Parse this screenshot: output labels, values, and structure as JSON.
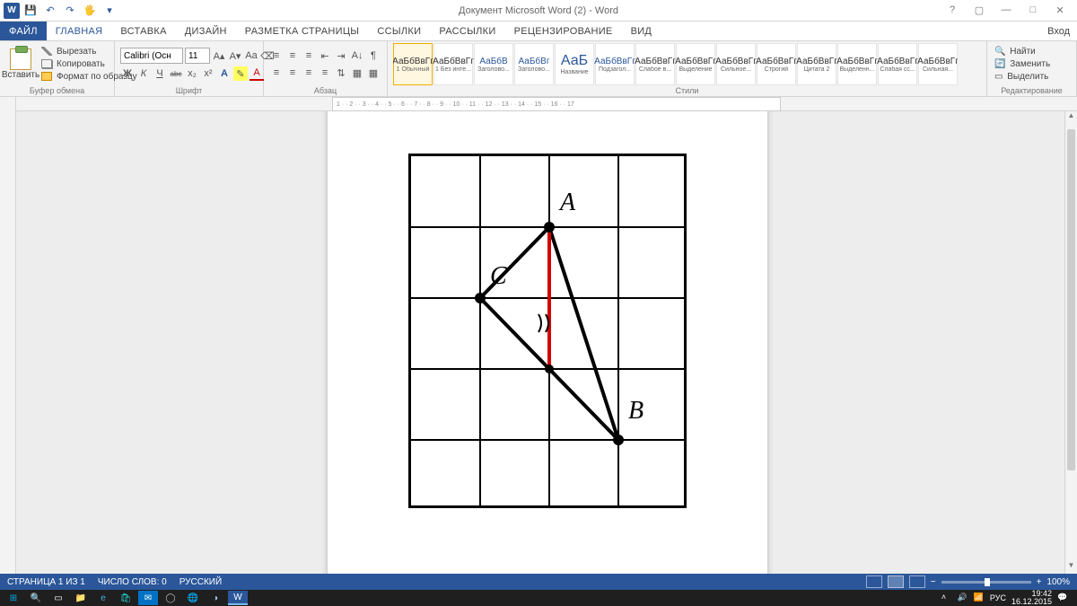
{
  "title": "Документ Microsoft Word (2) - Word",
  "qat": {
    "save": "💾",
    "undo": "↶",
    "redo": "↷",
    "touch": "🖐"
  },
  "win": {
    "help": "?",
    "ribopts": "▢",
    "min": "—",
    "max": "□",
    "close": "✕"
  },
  "tabs": {
    "file": "ФАЙЛ",
    "items": [
      "ГЛАВНАЯ",
      "ВСТАВКА",
      "ДИЗАЙН",
      "РАЗМЕТКА СТРАНИЦЫ",
      "ССЫЛКИ",
      "РАССЫЛКИ",
      "РЕЦЕНЗИРОВАНИЕ",
      "ВИД"
    ],
    "active": 0,
    "signin": "Вход"
  },
  "ribbon": {
    "clipboard": {
      "paste": "Вставить",
      "cut": "Вырезать",
      "copy": "Копировать",
      "format": "Формат по образцу",
      "label": "Буфер обмена"
    },
    "font": {
      "name": "Calibri (Осн",
      "size": "11",
      "grow": "A▴",
      "shrink": "A▾",
      "case": "Aa",
      "clear": "⌫",
      "bold": "Ж",
      "italic": "К",
      "underline": "Ч",
      "strike": "abc",
      "sub": "x₂",
      "sup": "x²",
      "effects": "A",
      "highlight": "✎",
      "color": "A",
      "label": "Шрифт"
    },
    "para": {
      "bul": "≡",
      "num": "≡",
      "ml": "≡",
      "dec": "⇤",
      "inc": "⇥",
      "sort": "A↓",
      "marks": "¶",
      "al": "≡",
      "ac": "≡",
      "ar": "≡",
      "aj": "≡",
      "ls": "⇅",
      "shade": "▦",
      "bord": "▦",
      "label": "Абзац"
    },
    "styles": {
      "items": [
        {
          "preview": "АаБбВвГг",
          "name": "1 Обычный",
          "cls": "",
          "sel": true
        },
        {
          "preview": "АаБбВвГг",
          "name": "1 Без инте...",
          "cls": ""
        },
        {
          "preview": "АаБбВ",
          "name": "Заголово...",
          "cls": "blue"
        },
        {
          "preview": "АаБбВг",
          "name": "Заголово...",
          "cls": "blue"
        },
        {
          "preview": "АаБ",
          "name": "Название",
          "cls": "big"
        },
        {
          "preview": "АаБбВвГг",
          "name": "Подзагол...",
          "cls": "blue"
        },
        {
          "preview": "АаБбВвГг",
          "name": "Слабое в...",
          "cls": ""
        },
        {
          "preview": "АаБбВвГг",
          "name": "Выделение",
          "cls": ""
        },
        {
          "preview": "АаБбВвГг",
          "name": "Сильное...",
          "cls": ""
        },
        {
          "preview": "АаБбВвГг",
          "name": "Строгий",
          "cls": ""
        },
        {
          "preview": "АаБбВвГг",
          "name": "Цитата 2",
          "cls": ""
        },
        {
          "preview": "АаБбВвГг",
          "name": "Выделенн...",
          "cls": ""
        },
        {
          "preview": "АаБбВвГг",
          "name": "Слабая сс...",
          "cls": ""
        },
        {
          "preview": "АаБбВвГг",
          "name": "Сильная...",
          "cls": ""
        }
      ],
      "label": "Стили"
    },
    "editing": {
      "find": "Найти",
      "replace": "Заменить",
      "select": "Выделить",
      "label": "Редактирование"
    }
  },
  "ruler": "1 · · 2 · · 3 · · 4 · · 5 · · 6 · · 7 · · 8 · · 9 · · 10 · · 11 · · 12 · · 13 · · 14 · · 15 · · 16 · · 17",
  "drawing": {
    "labelA": "A",
    "labelB": "B",
    "labelC": "C"
  },
  "status": {
    "page": "СТРАНИЦА 1 ИЗ 1",
    "words": "ЧИСЛО СЛОВ: 0",
    "lang": "РУССКИЙ",
    "zoom": "100%"
  },
  "tray": {
    "lang": "РУС",
    "time": "19:42",
    "date": "16.12.2015"
  }
}
